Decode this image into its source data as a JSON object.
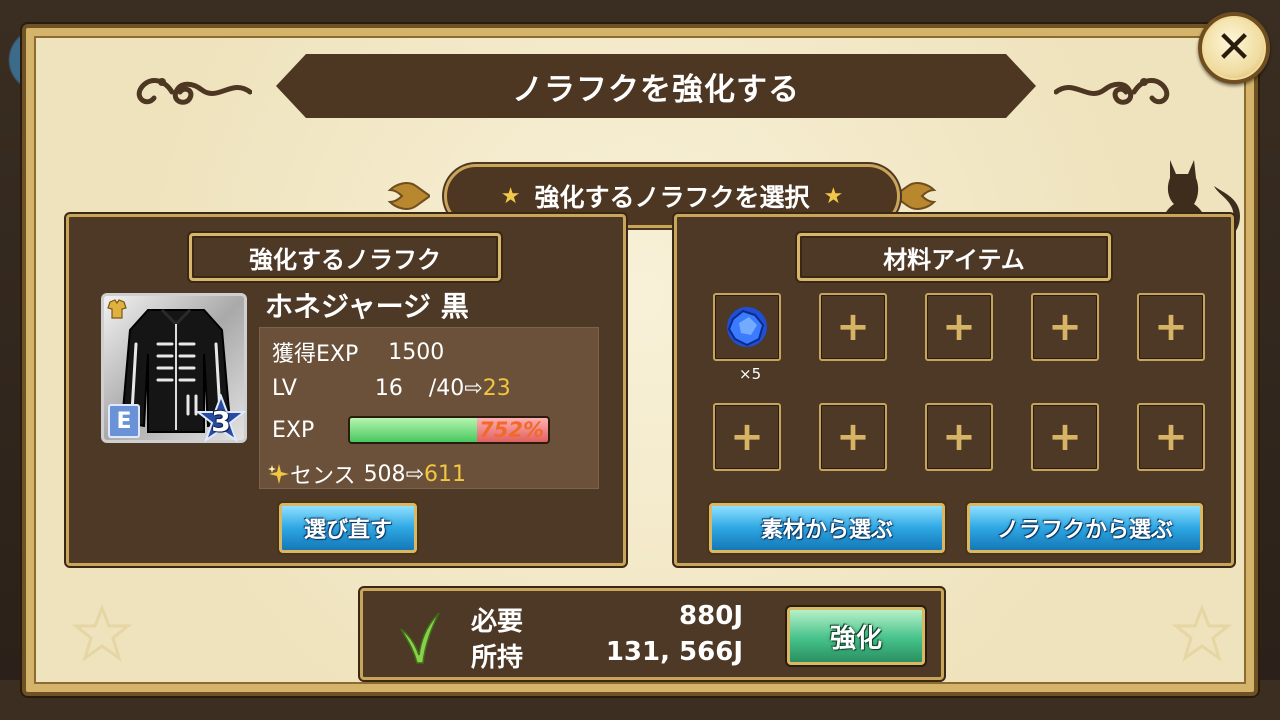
{
  "title": "ノラフクを強化する",
  "subtitle": "強化するノラフクを選択",
  "icons": {
    "close": "close-icon",
    "cat": "cat-silhouette-icon",
    "grass": "grass-icon",
    "sparkle": "sparkle-icon"
  },
  "left_panel": {
    "header": "強化するノラフク",
    "item_name": "ホネジャージ 黒",
    "rank": "E",
    "stars": "3",
    "stats": {
      "exp_label": "獲得EXP",
      "exp_value": "1500",
      "lv_label": "LV",
      "lv_current": "16",
      "lv_max": "/40",
      "lv_next": "23",
      "exp_bar_label": "EXP",
      "exp_percent": "752%",
      "exp_fill_fraction": 0.64,
      "sense_label": "センス",
      "sense_current": "508",
      "sense_next": "611",
      "arrow": "⇨"
    },
    "reselect_button": "選び直す"
  },
  "right_panel": {
    "header": "材料アイテム",
    "slot_plus": "+",
    "first_slot_count": "×5",
    "material_button": "素材から選ぶ",
    "norafuku_button": "ノラフクから選ぶ"
  },
  "cost": {
    "required_label": "必要",
    "required_value": "880J",
    "owned_label": "所持",
    "owned_value": "131, 566J",
    "enhance_button": "強化"
  },
  "colors": {
    "panel_brown": "#4e3826",
    "gold_border": "#c9a55a",
    "highlight_yellow": "#f2c640",
    "exp_green": "#48c860",
    "button_blue": "#2ea7e3",
    "button_green": "#46c28a"
  }
}
